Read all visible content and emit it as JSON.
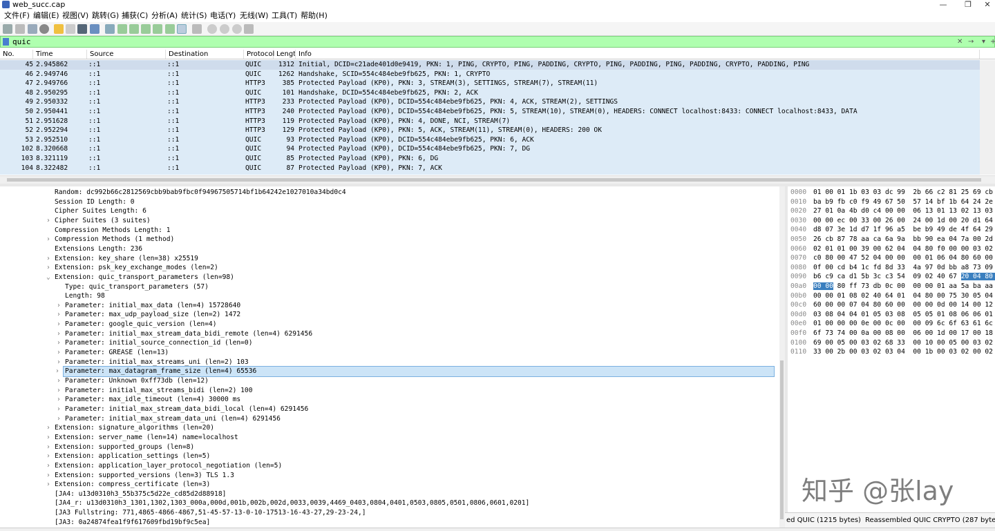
{
  "window": {
    "title": "web_succ.cap",
    "min": "—",
    "restore": "❐",
    "close": "✕"
  },
  "menu": [
    "文件(F)",
    "编辑(E)",
    "视图(V)",
    "跳转(G)",
    "捕获(C)",
    "分析(A)",
    "统计(S)",
    "电话(Y)",
    "无线(W)",
    "工具(T)",
    "帮助(H)"
  ],
  "filter": {
    "value": "quic",
    "clear": "✕",
    "apply": "→",
    "dropdown": "▾",
    "add": "+"
  },
  "columns": [
    "No.",
    "Time",
    "Source",
    "Destination",
    "Protocol",
    "Length",
    "Info"
  ],
  "packets": [
    {
      "no": "45",
      "time": "2.945862",
      "src": "::1",
      "dst": "::1",
      "proto": "QUIC",
      "len": "1312",
      "info": "Initial, DCID=c21ade401d0e9419, PKN: 1, PING, CRYPTO, PING, PADDING, CRYPTO, PING, PADDING, PING, PADDING, CRYPTO, PADDING, PING"
    },
    {
      "no": "46",
      "time": "2.949746",
      "src": "::1",
      "dst": "::1",
      "proto": "QUIC",
      "len": "1262",
      "info": "Handshake, SCID=554c484ebe9fb625, PKN: 1, CRYPTO"
    },
    {
      "no": "47",
      "time": "2.949766",
      "src": "::1",
      "dst": "::1",
      "proto": "HTTP3",
      "len": "385",
      "info": "Protected Payload (KP0), PKN: 3, STREAM(3), SETTINGS, STREAM(7), STREAM(11)"
    },
    {
      "no": "48",
      "time": "2.950295",
      "src": "::1",
      "dst": "::1",
      "proto": "QUIC",
      "len": "101",
      "info": "Handshake, DCID=554c484ebe9fb625, PKN: 2, ACK"
    },
    {
      "no": "49",
      "time": "2.950332",
      "src": "::1",
      "dst": "::1",
      "proto": "HTTP3",
      "len": "233",
      "info": "Protected Payload (KP0), DCID=554c484ebe9fb625, PKN: 4, ACK, STREAM(2), SETTINGS"
    },
    {
      "no": "50",
      "time": "2.950441",
      "src": "::1",
      "dst": "::1",
      "proto": "HTTP3",
      "len": "240",
      "info": "Protected Payload (KP0), DCID=554c484ebe9fb625, PKN: 5, STREAM(10), STREAM(0), HEADERS: CONNECT localhost:8433: CONNECT localhost:8433, DATA"
    },
    {
      "no": "51",
      "time": "2.951628",
      "src": "::1",
      "dst": "::1",
      "proto": "HTTP3",
      "len": "119",
      "info": "Protected Payload (KP0), PKN: 4, DONE, NCI, STREAM(7)"
    },
    {
      "no": "52",
      "time": "2.952294",
      "src": "::1",
      "dst": "::1",
      "proto": "HTTP3",
      "len": "129",
      "info": "Protected Payload (KP0), PKN: 5, ACK, STREAM(11), STREAM(0), HEADERS: 200 OK"
    },
    {
      "no": "53",
      "time": "2.952510",
      "src": "::1",
      "dst": "::1",
      "proto": "QUIC",
      "len": "93",
      "info": "Protected Payload (KP0), DCID=554c484ebe9fb625, PKN: 6, ACK"
    },
    {
      "no": "102",
      "time": "8.320668",
      "src": "::1",
      "dst": "::1",
      "proto": "QUIC",
      "len": "94",
      "info": "Protected Payload (KP0), DCID=554c484ebe9fb625, PKN: 7, DG"
    },
    {
      "no": "103",
      "time": "8.321119",
      "src": "::1",
      "dst": "::1",
      "proto": "QUIC",
      "len": "85",
      "info": "Protected Payload (KP0), PKN: 6, DG"
    },
    {
      "no": "104",
      "time": "8.322482",
      "src": "::1",
      "dst": "::1",
      "proto": "QUIC",
      "len": "87",
      "info": "Protected Payload (KP0), PKN: 7, ACK"
    }
  ],
  "details": [
    {
      "t": "Random: dc992b66c2812569cbb9bab9fbc0f94967505714bf1b64242e1027010a34bd0c4",
      "lvl": 0,
      "tri": ""
    },
    {
      "t": "Session ID Length: 0",
      "lvl": 0,
      "tri": ""
    },
    {
      "t": "Cipher Suites Length: 6",
      "lvl": 0,
      "tri": ""
    },
    {
      "t": "Cipher Suites (3 suites)",
      "lvl": 0,
      "tri": ">"
    },
    {
      "t": "Compression Methods Length: 1",
      "lvl": 0,
      "tri": ""
    },
    {
      "t": "Compression Methods (1 method)",
      "lvl": 0,
      "tri": ">"
    },
    {
      "t": "Extensions Length: 236",
      "lvl": 0,
      "tri": ""
    },
    {
      "t": "Extension: key_share (len=38) x25519",
      "lvl": 0,
      "tri": ">"
    },
    {
      "t": "Extension: psk_key_exchange_modes (len=2)",
      "lvl": 0,
      "tri": ">"
    },
    {
      "t": "Extension: quic_transport_parameters (len=98)",
      "lvl": 0,
      "tri": "v"
    },
    {
      "t": "Type: quic_transport_parameters (57)",
      "lvl": 1,
      "tri": ""
    },
    {
      "t": "Length: 98",
      "lvl": 1,
      "tri": ""
    },
    {
      "t": "Parameter: initial_max_data (len=4) 15728640",
      "lvl": 1,
      "tri": ">"
    },
    {
      "t": "Parameter: max_udp_payload_size (len=2) 1472",
      "lvl": 1,
      "tri": ">"
    },
    {
      "t": "Parameter: google_quic_version (len=4)",
      "lvl": 1,
      "tri": ">"
    },
    {
      "t": "Parameter: initial_max_stream_data_bidi_remote (len=4) 6291456",
      "lvl": 1,
      "tri": ">"
    },
    {
      "t": "Parameter: initial_source_connection_id (len=0)",
      "lvl": 1,
      "tri": ">"
    },
    {
      "t": "Parameter: GREASE (len=13)",
      "lvl": 1,
      "tri": ">"
    },
    {
      "t": "Parameter: initial_max_streams_uni (len=2) 103",
      "lvl": 1,
      "tri": ">"
    },
    {
      "t": "Parameter: max_datagram_frame_size (len=4) 65536",
      "lvl": 1,
      "tri": ">",
      "sel": true
    },
    {
      "t": "Parameter: Unknown 0xff73db (len=12)",
      "lvl": 1,
      "tri": ">"
    },
    {
      "t": "Parameter: initial_max_streams_bidi (len=2) 100",
      "lvl": 1,
      "tri": ">"
    },
    {
      "t": "Parameter: max_idle_timeout (len=4) 30000 ms",
      "lvl": 1,
      "tri": ">"
    },
    {
      "t": "Parameter: initial_max_stream_data_bidi_local (len=4) 6291456",
      "lvl": 1,
      "tri": ">"
    },
    {
      "t": "Parameter: initial_max_stream_data_uni (len=4) 6291456",
      "lvl": 1,
      "tri": ">"
    },
    {
      "t": "Extension: signature_algorithms (len=20)",
      "lvl": 0,
      "tri": ">"
    },
    {
      "t": "Extension: server_name (len=14) name=localhost",
      "lvl": 0,
      "tri": ">"
    },
    {
      "t": "Extension: supported_groups (len=8)",
      "lvl": 0,
      "tri": ">"
    },
    {
      "t": "Extension: application_settings (len=5)",
      "lvl": 0,
      "tri": ">"
    },
    {
      "t": "Extension: application_layer_protocol_negotiation (len=5)",
      "lvl": 0,
      "tri": ">"
    },
    {
      "t": "Extension: supported_versions (len=3) TLS 1.3",
      "lvl": 0,
      "tri": ">"
    },
    {
      "t": "Extension: compress_certificate (len=3)",
      "lvl": 0,
      "tri": ">"
    },
    {
      "t": "[JA4: u13d0310h3_55b375c5d22e_cd85d2d88918]",
      "lvl": 0,
      "tri": ""
    },
    {
      "t": "[JA4_r: u13d0310h3_1301,1302,1303_000a,000d,001b,002b,002d,0033,0039,4469_0403,0804,0401,0503,0805,0501,0806,0601,0201]",
      "lvl": 0,
      "tri": ""
    },
    {
      "t": "[JA3 Fullstring: 771,4865-4866-4867,51-45-57-13-0-10-17513-16-43-27,29-23-24,]",
      "lvl": 0,
      "tri": ""
    },
    {
      "t": "[JA3: 0a24874fea1f9f617609fbd19bf9c5ea]",
      "lvl": 0,
      "tri": ""
    }
  ],
  "hex": [
    {
      "off": "0000",
      "b": "01 00 01 1b 03 03 dc 99  2b 66 c2 81 25 69 cb b9"
    },
    {
      "off": "0010",
      "b": "ba b9 fb c0 f9 49 67 50  57 14 bf 1b 64 24 2e 10"
    },
    {
      "off": "0020",
      "b": "27 01 0a 4b d0 c4 00 00  06 13 01 13 02 13 03 01"
    },
    {
      "off": "0030",
      "b": "00 00 ec 00 33 00 26 00  24 00 1d 00 20 d1 64 ed"
    },
    {
      "off": "0040",
      "b": "d8 07 3e 1d d7 1f 96 a5  be b9 49 de 4f 64 29 14"
    },
    {
      "off": "0050",
      "b": "26 cb 87 78 aa ca 6a 9a  bb 90 ea 04 7a 00 2d 00"
    },
    {
      "off": "0060",
      "b": "02 01 01 00 39 00 62 04  04 80 f0 00 00 03 02 45"
    },
    {
      "off": "0070",
      "b": "c0 80 00 47 52 04 00 00  00 01 06 04 80 60 00 00"
    },
    {
      "off": "0080",
      "b": "0f 00 cd b4 1c fd 8d 33  4a 97 0d bb a8 73 09 e0"
    },
    {
      "off": "0090",
      "b": "b6 c9 ca d1 5b 3c c3 54  09 02 40 67 ",
      "h": "20 04 80 01"
    },
    {
      "off": "00a0",
      "h": "00 00",
      "b": " 80 ff 73 db 0c 00  00 00 01 aa 5a ba aa 00"
    },
    {
      "off": "00b0",
      "b": "00 00 01 08 02 40 64 01  04 80 00 75 30 05 04 80"
    },
    {
      "off": "00c0",
      "b": "60 00 00 07 04 80 60 00  00 00 0d 00 14 00 12 04"
    },
    {
      "off": "00d0",
      "b": "03 08 04 04 01 05 03 08  05 05 01 08 06 06 01 02"
    },
    {
      "off": "00e0",
      "b": "01 00 00 00 0e 00 0c 00  00 09 6c 6f 63 61 6c 68"
    },
    {
      "off": "00f0",
      "b": "6f 73 74 00 0a 00 08 00  06 00 1d 00 17 00 18 44"
    },
    {
      "off": "0100",
      "b": "69 00 05 00 03 02 68 33  00 10 00 05 00 03 02 68"
    },
    {
      "off": "0110",
      "b": "33 00 2b 00 03 02 03 04  00 1b 00 03 02 00 02"
    }
  ],
  "bytetabs": [
    "ed QUIC (1215 bytes)",
    "Reassembled QUIC CRYPTO (287 bytes)"
  ],
  "watermark": "知乎 @张lay"
}
